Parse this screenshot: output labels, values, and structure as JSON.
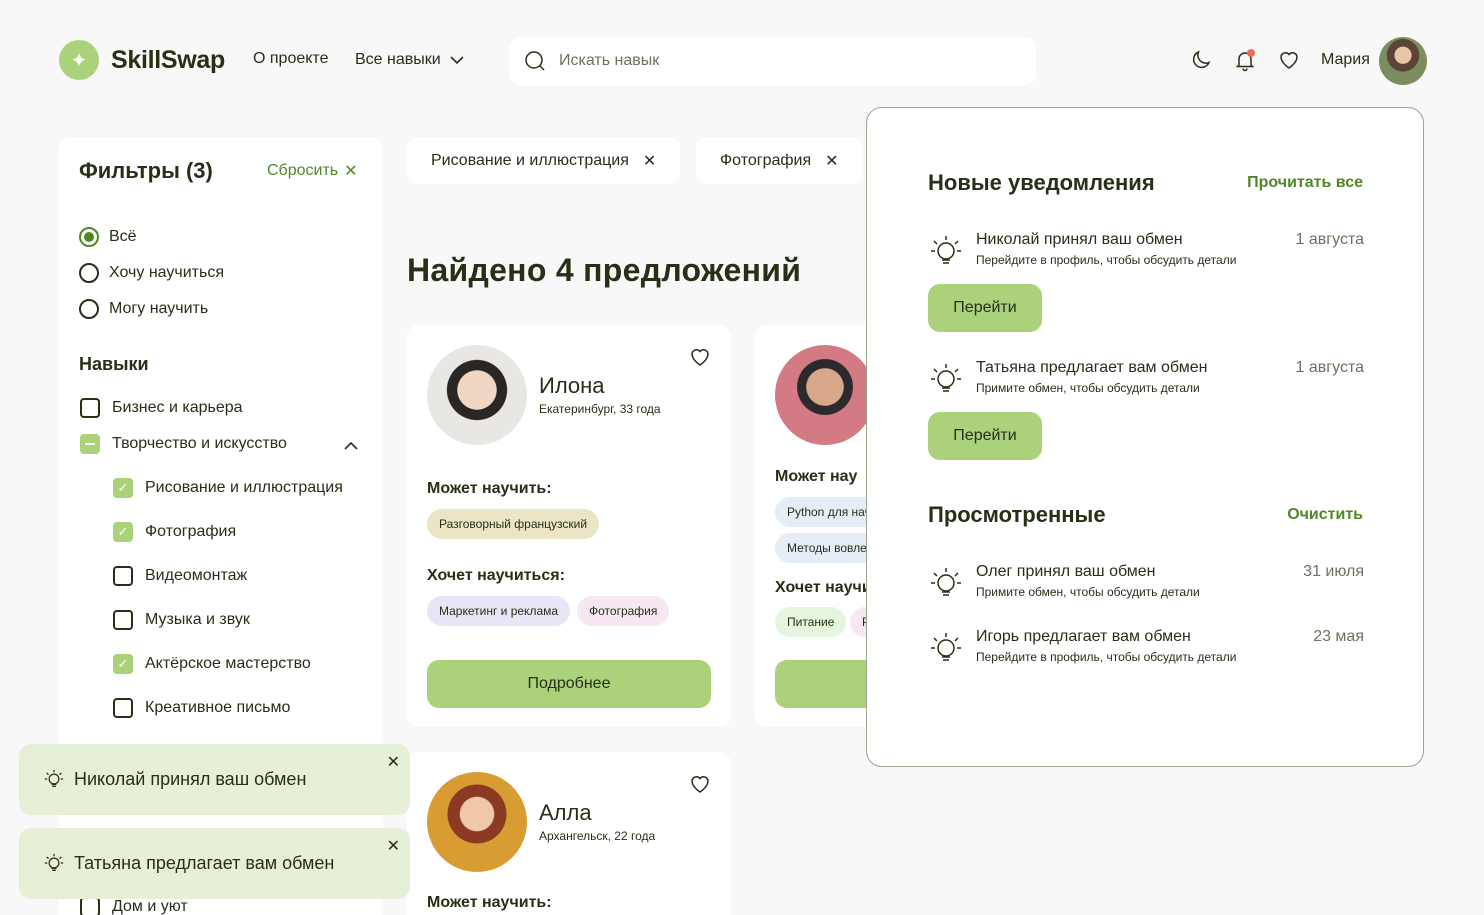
{
  "header": {
    "logo_text": "SkillSwap",
    "nav_about": "О проекте",
    "nav_skills": "Все навыки",
    "search_placeholder": "Искать навык",
    "user_name": "Мария"
  },
  "sidebar": {
    "filters_title": "Фильтры (3)",
    "reset_label": "Сбросить",
    "radios": [
      {
        "label": "Всё",
        "selected": true
      },
      {
        "label": "Хочу научиться",
        "selected": false
      },
      {
        "label": "Могу научить",
        "selected": false
      }
    ],
    "skills_title": "Навыки",
    "categories": [
      {
        "label": "Бизнес и карьера",
        "state": "off"
      },
      {
        "label": "Творчество и искусство",
        "state": "partial"
      }
    ],
    "subskills": [
      {
        "label": "Рисование и иллюстрация",
        "checked": true
      },
      {
        "label": "Фотография",
        "checked": true
      },
      {
        "label": "Видеомонтаж",
        "checked": false
      },
      {
        "label": "Музыка и звук",
        "checked": false
      },
      {
        "label": "Актёрское мастерство",
        "checked": true
      },
      {
        "label": "Креативное письмо",
        "checked": false
      }
    ],
    "bottom_item": "Дом и уют"
  },
  "chips": [
    {
      "label": "Рисование и иллюстрация"
    },
    {
      "label": "Фотография"
    }
  ],
  "found_title": "Найдено 4 предложений",
  "cards": [
    {
      "name": "Илона",
      "meta": "Екатеринбург, 33 года",
      "can_teach_label": "Может научить:",
      "can_teach": [
        "Разговорный французский"
      ],
      "wants_label": "Хочет научиться:",
      "wants": [
        "Маркетинг и реклама",
        "Фотография"
      ],
      "button": "Подробнее"
    },
    {
      "can_teach_label": "Может нау",
      "can_teach": [
        "Python для нач",
        "Методы вовле"
      ],
      "wants_label": "Хочет научи",
      "wants": [
        "Питание",
        "Р"
      ]
    },
    {
      "name": "Алла",
      "meta": "Архангельск, 22 года",
      "can_teach_label": "Может научить:"
    }
  ],
  "notifications": {
    "new_title": "Новые уведомления",
    "read_all": "Прочитать все",
    "new_items": [
      {
        "title": "Николай принял ваш обмен",
        "sub": "Перейдите в профиль, чтобы обсудить детали",
        "date": "1 августа",
        "button": "Перейти"
      },
      {
        "title": "Татьяна предлагает вам обмен",
        "sub": "Примите обмен, чтобы обсудить детали",
        "date": "1 августа",
        "button": "Перейти"
      }
    ],
    "viewed_title": "Просмотренные",
    "clear": "Очистить",
    "viewed_items": [
      {
        "title": "Олег принял ваш обмен",
        "sub": "Примите обмен, чтобы обсудить детали",
        "date": "31 июля"
      },
      {
        "title": "Игорь предлагает вам обмен",
        "sub": "Перейдите в профиль, чтобы обсудить детали",
        "date": "23 мая"
      }
    ]
  },
  "toasts": [
    {
      "text": "Николай принял ваш обмен"
    },
    {
      "text": "Татьяна предлагает вам обмен"
    }
  ],
  "colors": {
    "accent": "#abd27a",
    "accent_dark": "#508826",
    "text": "#253017",
    "background": "#f8f8f8",
    "toast_bg": "#e6f0d6",
    "notification_dot": "#e66f5c"
  },
  "icons": {
    "logo": "sparkle-icon",
    "search": "search-icon",
    "theme": "moon-icon",
    "notifications": "bell-icon",
    "favorites": "heart-icon",
    "notification_item": "lightbulb-icon",
    "close": "close-icon"
  }
}
